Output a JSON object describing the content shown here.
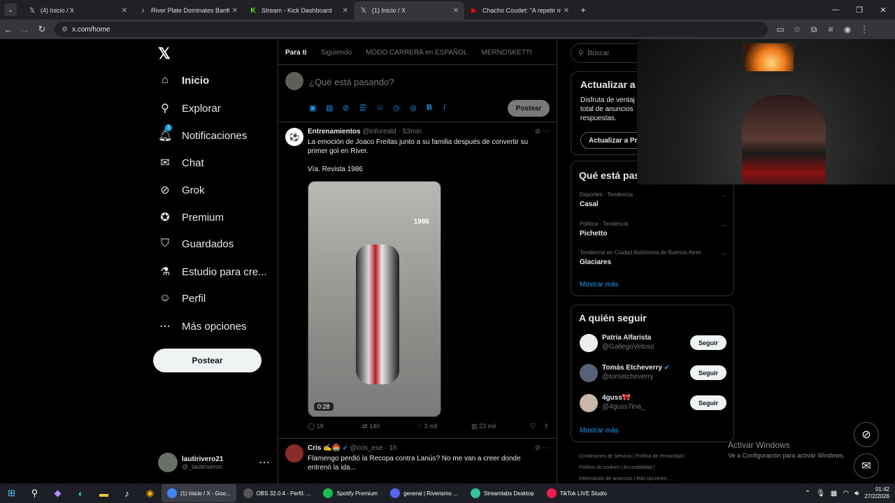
{
  "browser": {
    "tabs": [
      {
        "title": "(4) Inicio / X",
        "icon": "x-logo-icon"
      },
      {
        "title": "River Plate Dominates Banfield",
        "icon": "tiktok-icon"
      },
      {
        "title": "Stream - Kick Dashboard",
        "icon": "kick-icon"
      },
      {
        "title": "(1) Inicio / X",
        "icon": "x-logo-icon",
        "active": true
      },
      {
        "title": "Chacho Coudet: \"A repetir mucho",
        "icon": "youtube-icon"
      }
    ],
    "url": "x.com/home"
  },
  "leftnav": {
    "items": [
      {
        "label": "Inicio",
        "icon": "home-icon"
      },
      {
        "label": "Explorar",
        "icon": "search-icon"
      },
      {
        "label": "Notificaciones",
        "icon": "bell-icon",
        "badge": "1"
      },
      {
        "label": "Chat",
        "icon": "mail-icon"
      },
      {
        "label": "Grok",
        "icon": "grok-icon"
      },
      {
        "label": "Premium",
        "icon": "verified-icon"
      },
      {
        "label": "Guardados",
        "icon": "bookmark-icon"
      },
      {
        "label": "Estudio para cre...",
        "icon": "flask-icon"
      },
      {
        "label": "Perfil",
        "icon": "person-icon"
      },
      {
        "label": "Más opciones",
        "icon": "more-circle-icon"
      }
    ],
    "post_label": "Postear",
    "account": {
      "name": "lautirivero21",
      "handle": "@_lautiriveroo"
    }
  },
  "main": {
    "tabs": [
      "Para ti",
      "Siguiendo",
      "MODO CARRERA en ESPAÑOL",
      "MERNOSKETTI"
    ],
    "composer": {
      "placeholder": "¿Qué está pasando?",
      "post_label": "Postear"
    },
    "tweets": [
      {
        "name": "Entrenamientos",
        "handle": "@inforeald",
        "time": "53min",
        "text": "La emoción de Joaco Freitas junto a su familia después de convertir su primer gol en River.",
        "text2": "Vía. Revista 1986",
        "media_duration": "0:28",
        "watermark": "1986",
        "replies": "19",
        "retweets": "140",
        "likes": "3 mil",
        "views": "23 mil"
      },
      {
        "name": "Cris ✍️🏟️",
        "handle": "@cris_ese",
        "time": "1h",
        "text": "Flamengo perdió la Recopa contra Lanús? No me van a creer donde entrenó la ida..."
      }
    ]
  },
  "right": {
    "search_placeholder": "Buscar",
    "premium": {
      "title": "Actualizar a P",
      "text": "Disfruta de ventaj total de anuncios respuestas.",
      "button": "Actualizar a Pr"
    },
    "trends_title": "Qué está pas",
    "trends": [
      {
        "category": "Deportes · Tendencia",
        "name": "Casal"
      },
      {
        "category": "Política · Tendencia",
        "name": "Pichetto"
      },
      {
        "category": "Tendencia en Ciudad Autónoma de Buenos Aires",
        "name": "Glaciares"
      }
    ],
    "show_more": "Mostrar más",
    "follow_title": "A quién seguir",
    "follow": [
      {
        "name": "Patria Alfarista",
        "handle": "@GallegoVeloso",
        "button": "Seguir"
      },
      {
        "name": "Tomás Etcheverry",
        "handle": "@tometcheverry",
        "button": "Seguir",
        "verified": true
      },
      {
        "name": "4guss🎀",
        "handle": "@4guss7ina_",
        "button": "Seguir"
      }
    ],
    "footer": [
      "Condiciones de Servicio",
      "Política de Privacidad",
      "Política de cookies",
      "Accesibilidad",
      "Información de anuncios",
      "Más opciones ..."
    ]
  },
  "activate": {
    "line1": "Activar Windows",
    "line2": "Ve a Configuración para activar Windows."
  },
  "taskbar": {
    "apps": [
      {
        "label": "(1) Inicio / X - Goo...",
        "color": "#4285f4"
      },
      {
        "label": "OBS 32.0.4 - Perfil: ...",
        "color": "#302e31"
      },
      {
        "label": "Spotify Premium",
        "color": "#1db954"
      },
      {
        "label": "general | Riverismo ...",
        "color": "#5865f2"
      },
      {
        "label": "Streamlabs Desktop",
        "color": "#31c3a2"
      },
      {
        "label": "TikTok LIVE Studio",
        "color": "#ee1d52"
      }
    ],
    "time": "01:42",
    "date": "27/2/2026"
  }
}
